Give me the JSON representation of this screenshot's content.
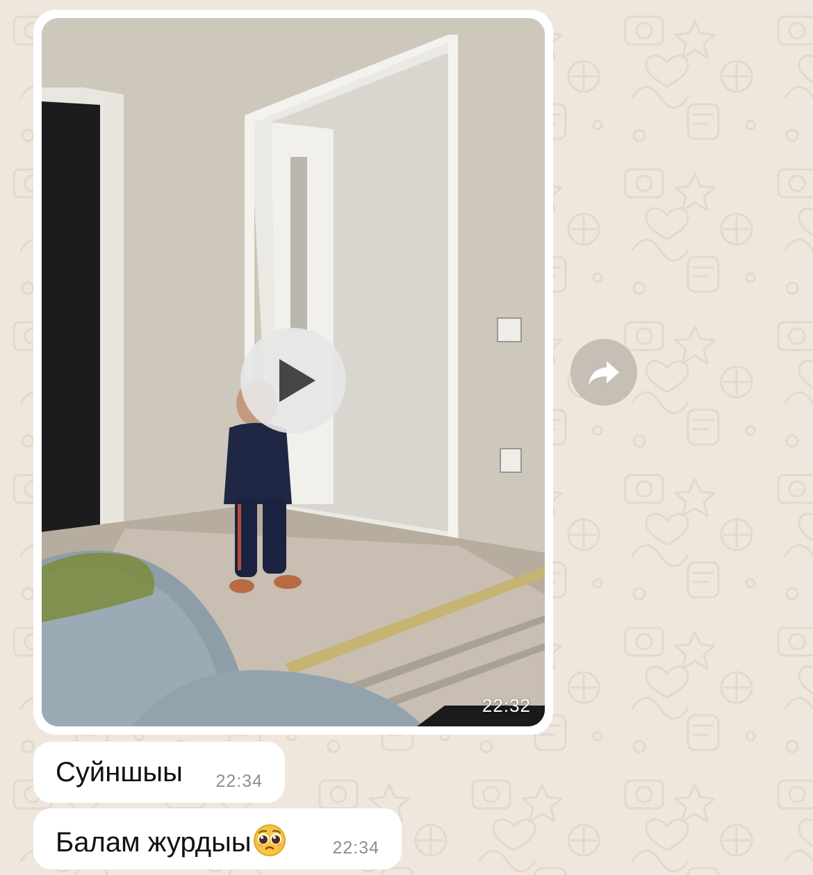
{
  "theme": {
    "wallpaper": "#efe7de",
    "bubble": "#ffffff",
    "timestamp": "#8b8f92"
  },
  "video_message": {
    "time": "22:32",
    "play_icon": "play-icon"
  },
  "forward": {
    "icon": "forward-arrow-icon"
  },
  "messages": [
    {
      "text": "Суйншыы",
      "time": "22:34"
    },
    {
      "text": "Балам журдыы",
      "emoji": "pleading-face-emoji",
      "time": "22:34"
    }
  ]
}
